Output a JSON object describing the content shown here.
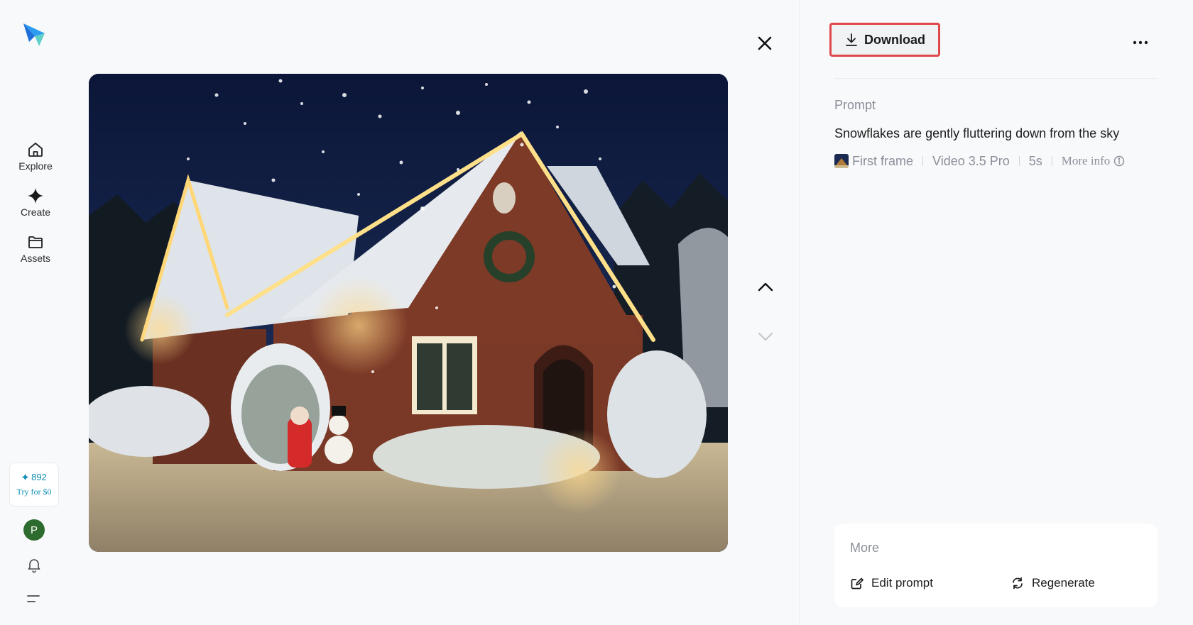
{
  "sidebar": {
    "logo": "app-logo",
    "items": [
      {
        "label": "Explore",
        "icon": "home-icon"
      },
      {
        "label": "Create",
        "icon": "sparkle-icon"
      },
      {
        "label": "Assets",
        "icon": "folder-icon"
      }
    ],
    "credits": {
      "count": "892",
      "cta": "Try for $0"
    },
    "avatar_initial": "P",
    "bell_icon": "bell-icon",
    "menu_icon": "menu-icon"
  },
  "viewer": {
    "image_subject": "snow-covered brick house with christmas lights at night",
    "close_icon": "close-icon",
    "prev_icon": "chevron-up-icon",
    "next_icon": "chevron-down-icon"
  },
  "panel": {
    "download_label": "Download",
    "more_options_icon": "ellipsis-icon",
    "prompt_label": "Prompt",
    "prompt_text": "Snowflakes are gently fluttering down from the sky",
    "meta": {
      "first_frame": "First frame",
      "model": "Video 3.5 Pro",
      "duration": "5s",
      "more_info": "More info"
    },
    "more": {
      "title": "More",
      "edit_prompt": "Edit prompt",
      "regenerate": "Regenerate"
    }
  },
  "colors": {
    "accent": "#0e8fb3",
    "highlight_border": "#e0474a",
    "avatar_bg": "#2e6b2f"
  }
}
